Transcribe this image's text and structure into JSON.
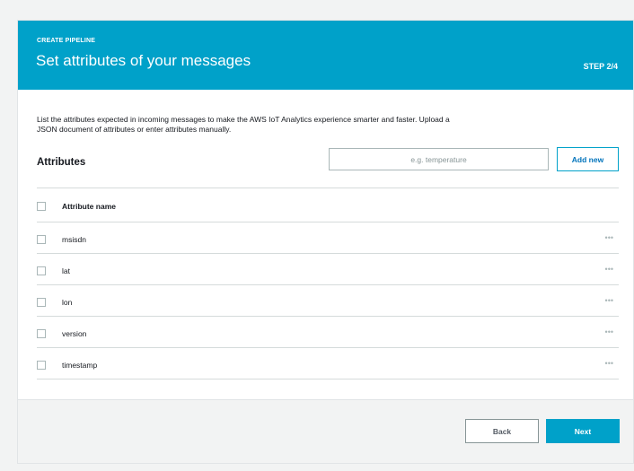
{
  "header": {
    "eyebrow": "CREATE PIPELINE",
    "title": "Set attributes of your messages",
    "step": "STEP 2/4"
  },
  "description": "List the attributes expected in incoming messages to make the AWS IoT Analytics experience smarter and faster. Upload a JSON document of attributes or enter attributes manually.",
  "attributes": {
    "title": "Attributes",
    "input_placeholder": "e.g. temperature",
    "add_label": "Add new",
    "column_header": "Attribute name",
    "rows": [
      {
        "name": "msisdn",
        "more": "•••"
      },
      {
        "name": "lat",
        "more": "•••"
      },
      {
        "name": "lon",
        "more": "•••"
      },
      {
        "name": "version",
        "more": "•••"
      },
      {
        "name": "timestamp",
        "more": "•••"
      }
    ]
  },
  "footer": {
    "back_label": "Back",
    "next_label": "Next"
  },
  "colors": {
    "accent": "#00a1c9",
    "link": "#0073bb"
  }
}
